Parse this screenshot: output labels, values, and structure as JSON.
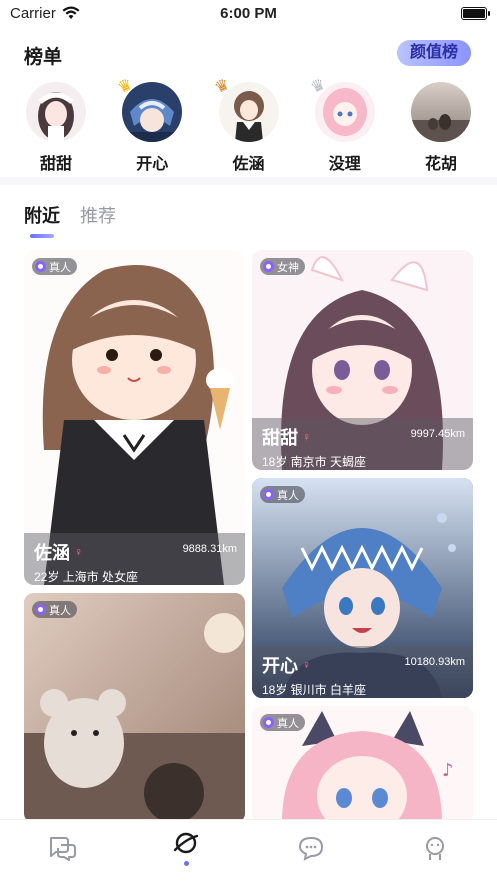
{
  "status_bar": {
    "carrier": "Carrier",
    "time": "6:00 PM"
  },
  "ranking": {
    "title": "榜单",
    "badge": "颜值榜",
    "items": [
      {
        "name": "甜甜",
        "crown": ""
      },
      {
        "name": "开心",
        "crown": "gold"
      },
      {
        "name": "佐涵",
        "crown": "bronze"
      },
      {
        "name": "没理",
        "crown": "silver"
      },
      {
        "name": "花胡",
        "crown": ""
      }
    ]
  },
  "tabs": [
    {
      "label": "附近",
      "active": true
    },
    {
      "label": "推荐",
      "active": false
    }
  ],
  "cards": [
    {
      "badge": "真人",
      "name": "佐涵",
      "meta": "22岁 上海市 处女座",
      "distance": "9888.31km"
    },
    {
      "badge": "女神",
      "name": "甜甜",
      "meta": "18岁 南京市 天蝎座",
      "distance": "9997.45km"
    },
    {
      "badge": "真人",
      "name": "开心",
      "meta": "18岁 银川市 白羊座",
      "distance": "10180.93km"
    },
    {
      "badge": "真人"
    },
    {
      "badge": "真人"
    }
  ],
  "bottom_nav": {
    "items": [
      {
        "icon": "chat-bubbles-icon"
      },
      {
        "icon": "planet-icon",
        "active": true
      },
      {
        "icon": "message-icon"
      },
      {
        "icon": "profile-icon"
      }
    ]
  },
  "colors": {
    "accent": "#6b6fff",
    "badge": "#8c93ff"
  }
}
